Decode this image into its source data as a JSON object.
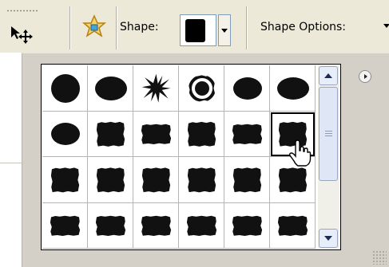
{
  "toolbar": {
    "shape_label": "Shape:",
    "shape_options_label": "Shape Options:"
  },
  "panel": {
    "selected_index": 11,
    "rows": 4,
    "columns": 6,
    "shapes": [
      "ragged-circle",
      "ragged-oval-wide",
      "starburst-splat",
      "ring-circle",
      "smooth-oval",
      "smooth-oval-wide",
      "smooth-oval",
      "ragged-square",
      "ragged-rect-wide",
      "ragged-square",
      "ragged-rect-wide",
      "ragged-square-selected",
      "ragged-square",
      "ragged-square",
      "ragged-square",
      "ragged-square",
      "ragged-square",
      "ragged-square",
      "ragged-rect-wide",
      "ragged-rect-wide",
      "ragged-rect-wide",
      "ragged-rect-wide",
      "ragged-rect-wide",
      "ragged-rect-wide"
    ]
  },
  "icons": {
    "move_tool": "move-tool-icon",
    "preset": "star-preset-icon",
    "menu": "panel-menu-icon",
    "cursor": "hand-cursor-icon"
  },
  "colors": {
    "toolbar_bg": "#ece9d8",
    "panel_bg": "#d4d0c8",
    "shape_fill": "#111111"
  }
}
